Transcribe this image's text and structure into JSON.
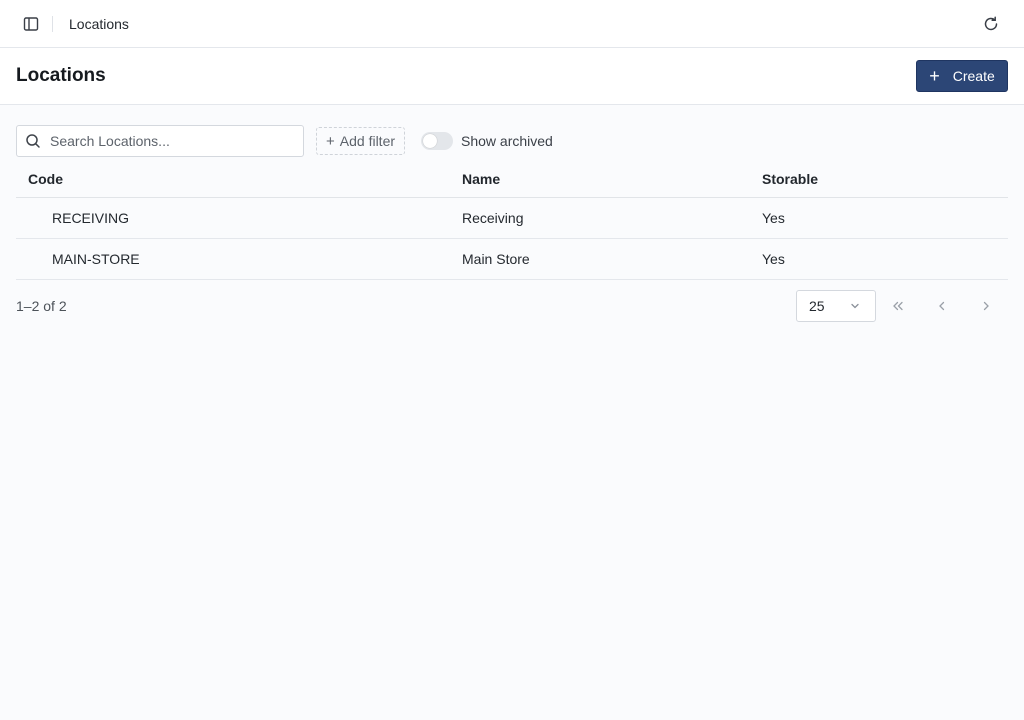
{
  "topbar": {
    "breadcrumb": "Locations"
  },
  "header": {
    "title": "Locations",
    "create_label": "Create"
  },
  "toolbar": {
    "search_placeholder": "Search Locations...",
    "add_filter_label": "Add filter",
    "show_archived_label": "Show archived",
    "show_archived_on": false
  },
  "table": {
    "columns": [
      "Code",
      "Name",
      "Storable"
    ],
    "rows": [
      {
        "code": "RECEIVING",
        "name": "Receiving",
        "storable": "Yes"
      },
      {
        "code": "MAIN-STORE",
        "name": "Main Store",
        "storable": "Yes"
      }
    ]
  },
  "footer": {
    "count_text": "1–2 of 2",
    "page_size": "25"
  },
  "colors": {
    "primary": "#2c4676",
    "background": "#fafbfd"
  }
}
